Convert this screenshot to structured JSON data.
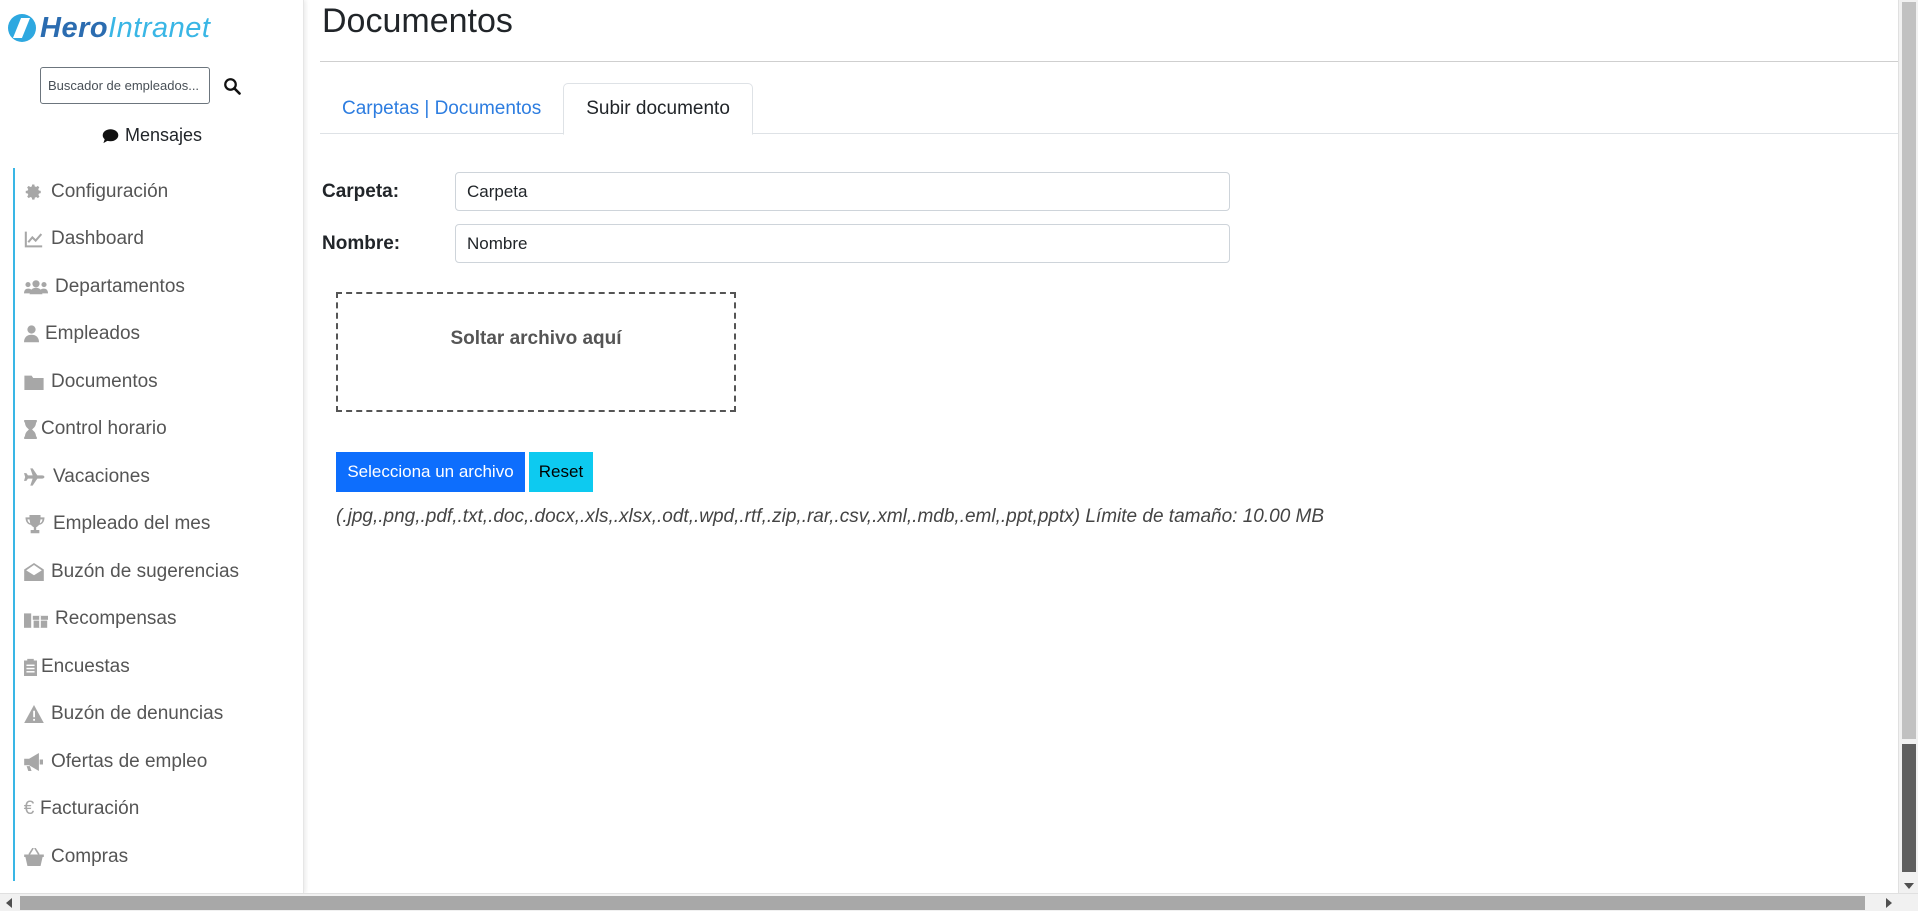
{
  "brand": {
    "part1": "Hero",
    "part2": "Intranet"
  },
  "search": {
    "placeholder": "Buscador de empleados..."
  },
  "messages": {
    "label": "Mensajes"
  },
  "sidebar": {
    "items": [
      {
        "label": "Configuración",
        "icon": "gear-icon"
      },
      {
        "label": "Dashboard",
        "icon": "chart-line-icon"
      },
      {
        "label": "Departamentos",
        "icon": "users-icon"
      },
      {
        "label": "Empleados",
        "icon": "user-icon"
      },
      {
        "label": "Documentos",
        "icon": "folder-icon"
      },
      {
        "label": "Control horario",
        "icon": "hourglass-icon"
      },
      {
        "label": "Vacaciones",
        "icon": "plane-icon"
      },
      {
        "label": "Empleado del mes",
        "icon": "trophy-icon"
      },
      {
        "label": "Buzón de sugerencias",
        "icon": "envelope-open-icon"
      },
      {
        "label": "Recompensas",
        "icon": "gifts-icon"
      },
      {
        "label": "Encuestas",
        "icon": "clipboard-list-icon"
      },
      {
        "label": "Buzón de denuncias",
        "icon": "warning-icon"
      },
      {
        "label": "Ofertas de empleo",
        "icon": "megaphone-icon"
      },
      {
        "label": "Facturación",
        "icon": "euro-icon"
      },
      {
        "label": "Compras",
        "icon": "basket-icon"
      }
    ]
  },
  "main": {
    "title": "Documentos",
    "tabs": [
      {
        "label": "Carpetas | Documentos"
      },
      {
        "label": "Subir documento"
      }
    ],
    "form": {
      "carpeta_label": "Carpeta:",
      "carpeta_placeholder": "Carpeta",
      "nombre_label": "Nombre:",
      "nombre_placeholder": "Nombre"
    },
    "dropzone": "Soltar archivo aquí",
    "buttons": {
      "select": "Selecciona un archivo",
      "reset": "Reset"
    },
    "hint": "(.jpg,.png,.pdf,.txt,.doc,.docx,.xls,.xlsx,.odt,.wpd,.rtf,.zip,.rar,.csv,.xml,.mdb,.eml,.ppt,pptx) Límite de tamaño: 10.00 MB"
  },
  "colors": {
    "accent": "#39b6e5",
    "primary": "#0d6efd",
    "info": "#0dcaf0",
    "link": "#2d7de0"
  }
}
